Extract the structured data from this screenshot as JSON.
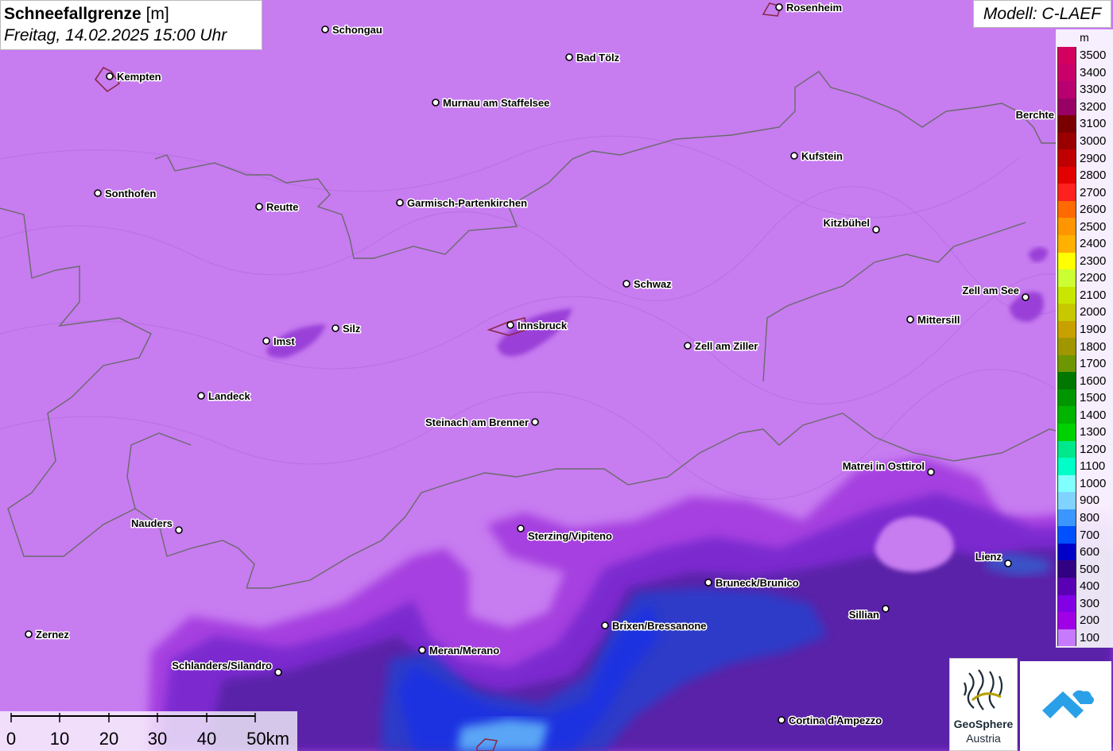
{
  "header": {
    "title_bold": "Schneefallgrenze",
    "title_unit": "[m]",
    "datetime": "Freitag, 14.02.2025 15:00 Uhr"
  },
  "model": {
    "label": "Modell: C-LAEF"
  },
  "legend": {
    "unit": "m",
    "entries": [
      {
        "label": "3500",
        "color": "#d4005f"
      },
      {
        "label": "3400",
        "color": "#c9006a"
      },
      {
        "label": "3300",
        "color": "#b80070"
      },
      {
        "label": "3200",
        "color": "#990066"
      },
      {
        "label": "3100",
        "color": "#7a0000"
      },
      {
        "label": "3000",
        "color": "#9a0000"
      },
      {
        "label": "2900",
        "color": "#c00000"
      },
      {
        "label": "2800",
        "color": "#e30000"
      },
      {
        "label": "2700",
        "color": "#ff2020"
      },
      {
        "label": "2600",
        "color": "#ff6a00"
      },
      {
        "label": "2500",
        "color": "#ff9500"
      },
      {
        "label": "2400",
        "color": "#ffb000"
      },
      {
        "label": "2300",
        "color": "#ffff00"
      },
      {
        "label": "2200",
        "color": "#ccff33"
      },
      {
        "label": "2100",
        "color": "#c8e600"
      },
      {
        "label": "2000",
        "color": "#c8c800"
      },
      {
        "label": "1900",
        "color": "#c8a000"
      },
      {
        "label": "1800",
        "color": "#a09600"
      },
      {
        "label": "1700",
        "color": "#6e9600"
      },
      {
        "label": "1600",
        "color": "#007800"
      },
      {
        "label": "1500",
        "color": "#009600"
      },
      {
        "label": "1400",
        "color": "#00b400"
      },
      {
        "label": "1300",
        "color": "#00d200"
      },
      {
        "label": "1200",
        "color": "#00e88c"
      },
      {
        "label": "1100",
        "color": "#00ffc8"
      },
      {
        "label": "1000",
        "color": "#80ffff"
      },
      {
        "label": "900",
        "color": "#80d2ff"
      },
      {
        "label": "800",
        "color": "#3c96ff"
      },
      {
        "label": "700",
        "color": "#0050ff"
      },
      {
        "label": "600",
        "color": "#0000c8"
      },
      {
        "label": "500",
        "color": "#320082"
      },
      {
        "label": "400",
        "color": "#5a00b4"
      },
      {
        "label": "300",
        "color": "#8200e6"
      },
      {
        "label": "200",
        "color": "#a000e6"
      },
      {
        "label": "100",
        "color": "#c87aff"
      }
    ]
  },
  "cities": [
    {
      "name": "Rosenheim"
    },
    {
      "name": "Schongau"
    },
    {
      "name": "Kempten"
    },
    {
      "name": "Bad Tölz"
    },
    {
      "name": "Murnau am Staffelsee"
    },
    {
      "name": "Berchte"
    },
    {
      "name": "Kufstein"
    },
    {
      "name": "Sonthofen"
    },
    {
      "name": "Reutte"
    },
    {
      "name": "Garmisch-Partenkirchen"
    },
    {
      "name": "Kitzbühel"
    },
    {
      "name": "Schwaz"
    },
    {
      "name": "Zell am See"
    },
    {
      "name": "Mittersill"
    },
    {
      "name": "Imst"
    },
    {
      "name": "Silz"
    },
    {
      "name": "Innsbruck"
    },
    {
      "name": "Zell am Ziller"
    },
    {
      "name": "Landeck"
    },
    {
      "name": "Steinach am Brenner"
    },
    {
      "name": "Matrei in Osttirol"
    },
    {
      "name": "Nauders"
    },
    {
      "name": "Sterzing/Vipiteno"
    },
    {
      "name": "Lienz"
    },
    {
      "name": "Bruneck/Brunico"
    },
    {
      "name": "Sillian"
    },
    {
      "name": "Zernez"
    },
    {
      "name": "Brixen/Bressanone"
    },
    {
      "name": "Meran/Merano"
    },
    {
      "name": "Schlanders/Silandro"
    },
    {
      "name": "Cortina d'Ampezzo"
    }
  ],
  "scale": {
    "labels": [
      "0",
      "10",
      "20",
      "30",
      "40",
      "50km"
    ]
  },
  "logos": {
    "geosphere_line1": "GeoSphere",
    "geosphere_line2": "Austria"
  }
}
